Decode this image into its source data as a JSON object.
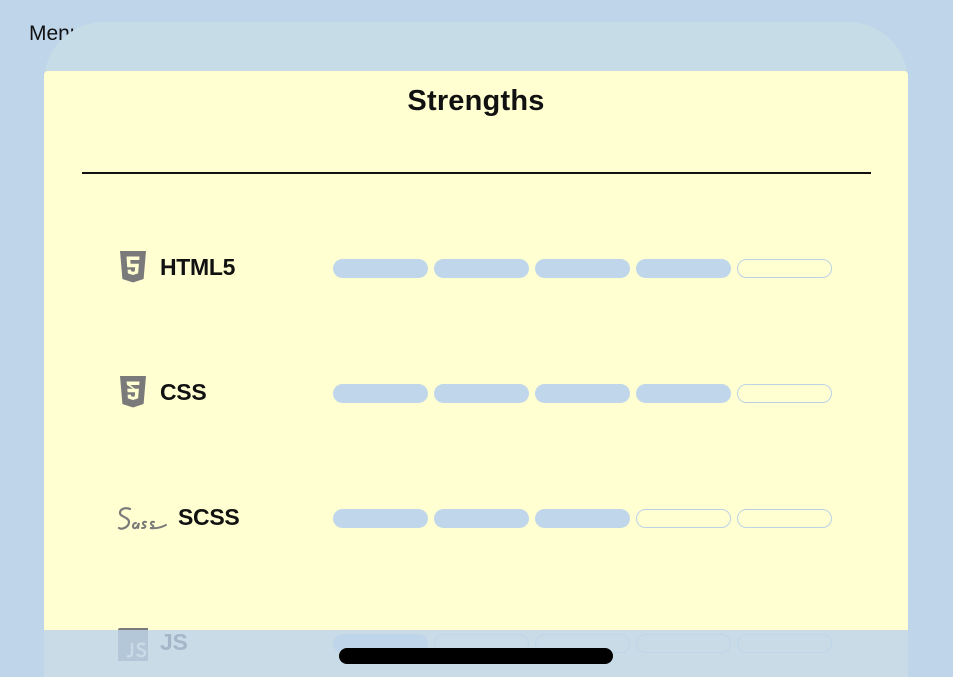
{
  "menu": {
    "label": "Menu"
  },
  "card": {
    "title": "Strengths"
  },
  "skills": [
    {
      "label": "HTML5",
      "icon": "html5-icon",
      "level": 4,
      "max": 5
    },
    {
      "label": "CSS",
      "icon": "css3-icon",
      "level": 4,
      "max": 5
    },
    {
      "label": "SCSS",
      "icon": "sass-icon",
      "level": 3,
      "max": 5
    },
    {
      "label": "JS",
      "icon": "javascript-icon",
      "level": 1,
      "max": 5
    }
  ],
  "colors": {
    "page_background": "#bed5ea",
    "card_background": "#ffffd2",
    "filled_segment": "#c0d6ea",
    "empty_segment_border": "#bcd3e6",
    "icon_gray": "#7a7a7a"
  }
}
